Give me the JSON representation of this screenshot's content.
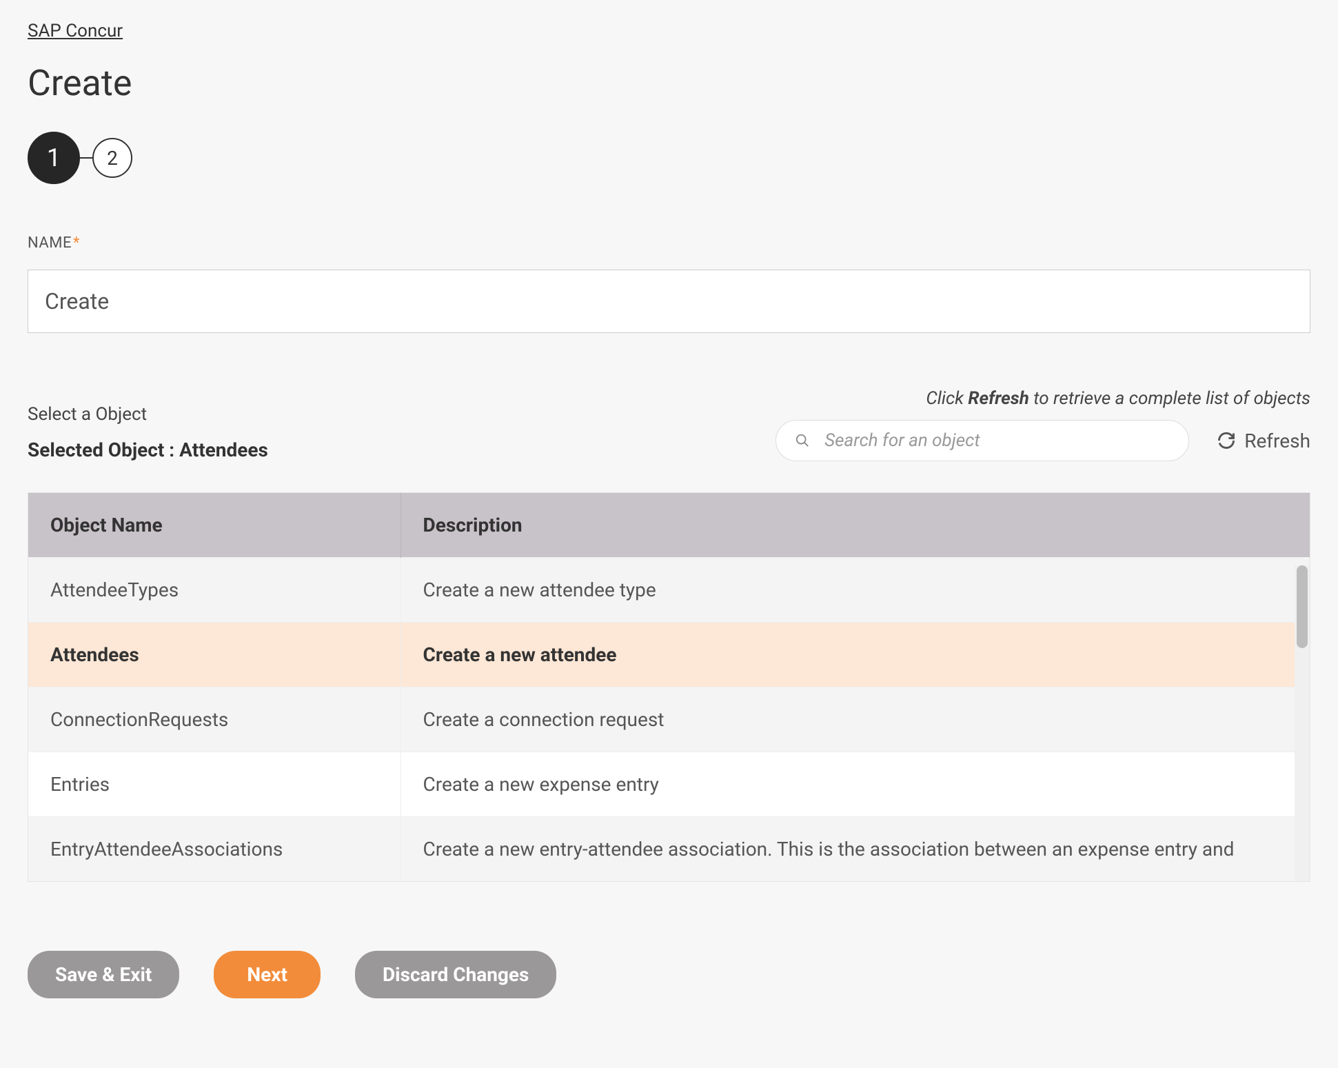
{
  "breadcrumb": {
    "parent": "SAP Concur"
  },
  "page": {
    "title": "Create"
  },
  "stepper": {
    "current": "1",
    "next": "2"
  },
  "nameField": {
    "label": "NAME",
    "value": "Create"
  },
  "selectObject": {
    "label": "Select a Object",
    "selectedPrefix": "Selected Object : ",
    "selectedValue": "Attendees",
    "refreshHintPre": "Click ",
    "refreshHintBold": "Refresh",
    "refreshHintPost": " to retrieve a complete list of objects",
    "searchPlaceholder": "Search for an object",
    "refreshLabel": "Refresh"
  },
  "table": {
    "headers": {
      "name": "Object Name",
      "desc": "Description"
    },
    "rows": [
      {
        "name": "AttendeeTypes",
        "desc": "Create a new attendee type",
        "selected": false
      },
      {
        "name": "Attendees",
        "desc": "Create a new attendee",
        "selected": true
      },
      {
        "name": "ConnectionRequests",
        "desc": "Create a connection request",
        "selected": false
      },
      {
        "name": "Entries",
        "desc": "Create a new expense entry",
        "selected": false
      },
      {
        "name": "EntryAttendeeAssociations",
        "desc": "Create a new entry-attendee association. This is the association between an expense entry and",
        "selected": false
      }
    ]
  },
  "footer": {
    "saveExit": "Save & Exit",
    "next": "Next",
    "discard": "Discard Changes"
  }
}
